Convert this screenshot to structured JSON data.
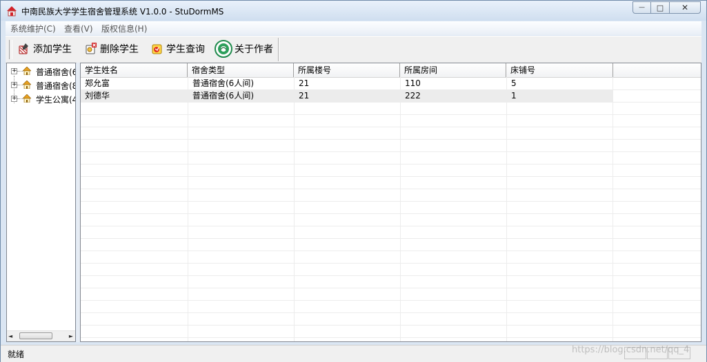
{
  "window": {
    "title": "中南民族大学学生宿舍管理系统 V1.0.0 - StuDormMS",
    "minimize_glyph": "—",
    "maximize_glyph": "□",
    "close_glyph": "✕"
  },
  "menu": {
    "items": [
      {
        "label": "系统维护(C)"
      },
      {
        "label": "查看(V)"
      },
      {
        "label": "版权信息(H)"
      }
    ]
  },
  "toolbar": {
    "buttons": [
      {
        "label": "添加学生",
        "icon": "add-student-icon"
      },
      {
        "label": "删除学生",
        "icon": "delete-student-icon"
      },
      {
        "label": "学生查询",
        "icon": "search-student-icon"
      },
      {
        "label": "关于作者",
        "icon": "university-logo-icon"
      }
    ]
  },
  "tree": {
    "items": [
      {
        "label": "普通宿舍(6",
        "expander": "+"
      },
      {
        "label": "普通宿舍(8",
        "expander": "+"
      },
      {
        "label": "学生公寓(4",
        "expander": "+"
      }
    ],
    "scroll_left": "◄",
    "scroll_right": "►"
  },
  "grid": {
    "columns": [
      "学生姓名",
      "宿舍类型",
      "所属楼号",
      "所属房间",
      "床铺号"
    ],
    "rows": [
      [
        "郑允富",
        "普通宿舍(6人间)",
        "21",
        "110",
        "5"
      ],
      [
        "刘德华",
        "普通宿舍(6人间)",
        "21",
        "222",
        "1"
      ]
    ]
  },
  "status": {
    "text": "就绪"
  },
  "watermark": "https://blog.csdn.net/qq_4",
  "colors": {
    "title_bar": "#dbe6f3",
    "grid_selected_row": "#ececec"
  }
}
